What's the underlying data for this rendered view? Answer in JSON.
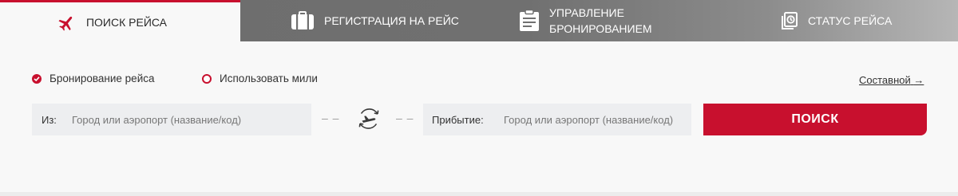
{
  "tabs": {
    "search_flight": "ПОИСК РЕЙСА",
    "checkin": "РЕГИСТРАЦИЯ НА РЕЙС",
    "manage_line1": "УПРАВЛЕНИЕ",
    "manage_line2": "БРОНИРОВАНИЕМ",
    "flight_status": "СТАТУС РЕЙСА",
    "icons": [
      "airplane-icon",
      "luggage-icon",
      "clipboard-icon",
      "status-clock-icon"
    ]
  },
  "options": {
    "booking": {
      "label": "Бронирование рейса",
      "selected": true
    },
    "miles": {
      "label": "Использовать мили",
      "selected": false
    }
  },
  "composite_link": "Составной",
  "composite_arrow": "→",
  "form": {
    "from_label": "Из:",
    "from_placeholder": "Город или аэропорт (название/код)",
    "to_label": "Прибытие:",
    "to_placeholder": "Город или аэропорт (название/код)",
    "dashes": "– –",
    "swap_icon": "swap-plane-icon",
    "search_button": "ПОИСК"
  },
  "colors": {
    "accent": "#c8102e",
    "tabbar": "#707070",
    "field_bg": "#edeef0",
    "panel_bg": "#f8f8f8"
  }
}
